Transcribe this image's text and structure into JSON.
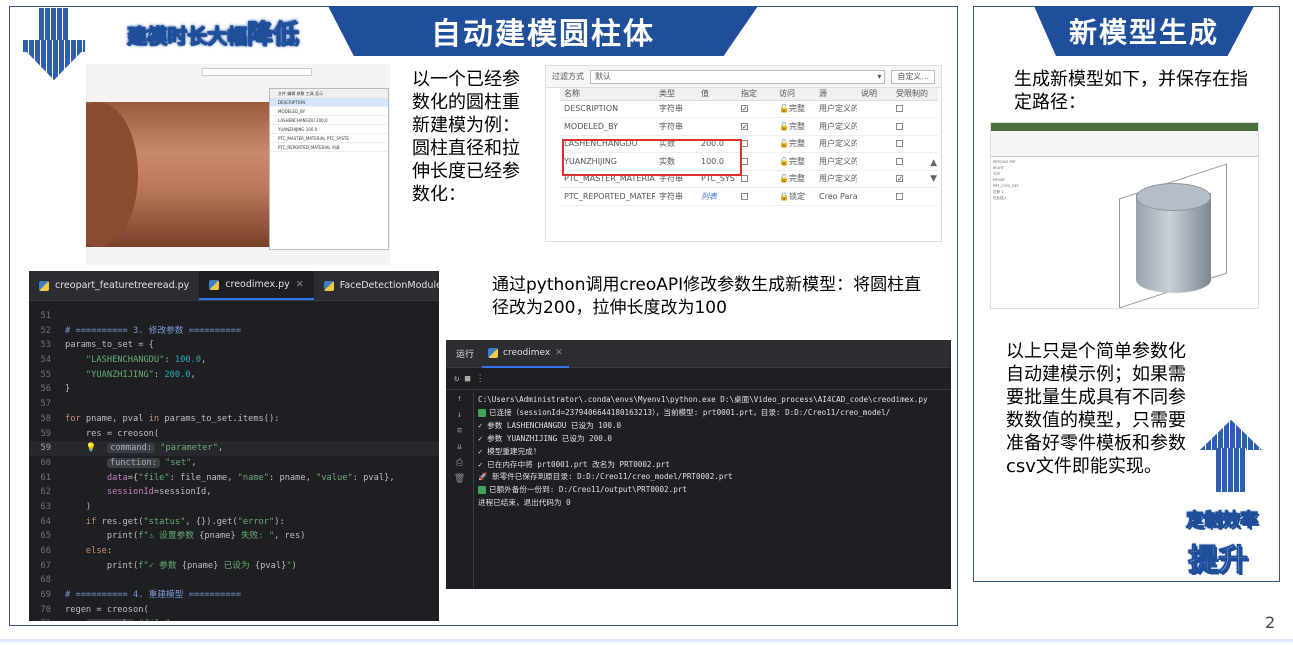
{
  "banners": {
    "left_title": "自动建模圆柱体",
    "right_title": "新模型生成"
  },
  "tags": {
    "reduce_prefix": "建模时长大幅",
    "reduce_big": "降低",
    "efficiency": "定制效率",
    "improve": "提升"
  },
  "texts": {
    "intro": "以一个已经参数化的圆柱重新建模为例：圆柱直径和拉伸长度已经参数化：",
    "python_desc": "通过python调用creoAPI修改参数生成新模型：将圆柱直径改为200，拉伸长度改为100",
    "new_model_desc": "生成新模型如下，并保存在指定路径：",
    "summary": "以上只是个简单参数化自动建模示例；如果需要批量生成具有不同参数数值的模型，只需要准备好零件模板和参数csv文件即能实现。"
  },
  "page_number": "2",
  "param_table": {
    "filter_label": "过滤方式",
    "filter_value": "默认",
    "custom_button": "自定义...",
    "headers": [
      "名称",
      "类型",
      "值",
      "指定",
      "访问",
      "源",
      "说明",
      "受限制的"
    ],
    "rows": [
      {
        "name": "DESCRIPTION",
        "type": "字符串",
        "value": "",
        "designated": true,
        "access": "🔓完整",
        "source": "用户定义的",
        "desc": "",
        "restricted": false
      },
      {
        "name": "MODELED_BY",
        "type": "字符串",
        "value": "",
        "designated": true,
        "access": "🔓完整",
        "source": "用户定义的",
        "desc": "",
        "restricted": false
      },
      {
        "name": "LASHENCHANGDU",
        "type": "实数",
        "value": "200.0",
        "designated": false,
        "access": "🔓完整",
        "source": "用户定义的",
        "desc": "",
        "restricted": false
      },
      {
        "name": "YUANZHIJING",
        "type": "实数",
        "value": "100.0",
        "designated": false,
        "access": "🔓完整",
        "source": "用户定义的",
        "desc": "",
        "restricted": false
      },
      {
        "name": "PTC_MASTER_MATERIAL",
        "type": "字符串",
        "value": "PTC_SYSTE",
        "designated": false,
        "access": "🔓完整",
        "source": "用户定义的",
        "desc": "",
        "restricted": true
      },
      {
        "name": "PTC_REPORTED_MATERIAL",
        "type": "字符串",
        "value": "列表",
        "designated": false,
        "access": "🔒锁定",
        "source": "Creo Para",
        "desc": "",
        "restricted": false
      }
    ]
  },
  "mini_dialog": {
    "menu": "文件  编辑  参数  工具  显示",
    "rows": [
      "DESCRIPTION",
      "MODELED_BY",
      "LASHENCHANGDU",
      "YUANZHIJING",
      "PTC_MASTER_MATERIAL",
      "PTC_REPORTED_MATERIAL"
    ],
    "values": [
      "",
      "",
      "200.0",
      "100.0",
      "PTC_SYSTE",
      "列表"
    ]
  },
  "editor": {
    "tabs": [
      "creopart_featuretreeread.py",
      "creodimex.py",
      "FaceDetectionModule.py"
    ],
    "active_tab": 1,
    "lines": [
      {
        "n": "51",
        "html": ""
      },
      {
        "n": "52",
        "html": "<span class=\"c-cm\"># ========== 3. 修改参数 ==========</span>"
      },
      {
        "n": "53",
        "html": "params_to_set = {"
      },
      {
        "n": "54",
        "html": "    <span class=\"c-st\">\"LASHENCHANGDU\"</span>: <span class=\"c-nm\">100.0</span>,"
      },
      {
        "n": "55",
        "html": "    <span class=\"c-st\">\"YUANZHIJING\"</span>: <span class=\"c-nm\">200.0</span>,"
      },
      {
        "n": "56",
        "html": "}"
      },
      {
        "n": "57",
        "html": ""
      },
      {
        "n": "58",
        "html": "<span class=\"c-kw\">for</span> pname, pval <span class=\"c-kw\">in</span> params_to_set.items():"
      },
      {
        "n": "59",
        "html": "    res = creoson("
      },
      {
        "n": "59",
        "html": "    💡  <span class=\"hint\">command:</span> <span class=\"c-st\">\"parameter\"</span>,",
        "cur": true
      },
      {
        "n": "60",
        "html": "        <span class=\"hint\">function:</span> <span class=\"c-st\">\"set\"</span>,"
      },
      {
        "n": "61",
        "html": "        <span class=\"c-pa\">data</span>={<span class=\"c-st\">\"file\"</span>: file_name, <span class=\"c-st\">\"name\"</span>: pname, <span class=\"c-st\">\"value\"</span>: pval},"
      },
      {
        "n": "62",
        "html": "        <span class=\"c-pa\">sessionId</span>=sessionId,"
      },
      {
        "n": "63",
        "html": "    )"
      },
      {
        "n": "64",
        "html": "    <span class=\"c-kw\">if</span> res.get(<span class=\"c-st\">\"status\"</span>, {}).get(<span class=\"c-st\">\"error\"</span>):"
      },
      {
        "n": "65",
        "html": "        print(<span class=\"c-st\">f\"⚠ 设置参数 </span>{pname}<span class=\"c-st\"> 失败: \"</span>, res)"
      },
      {
        "n": "66",
        "html": "    <span class=\"c-kw\">else</span>:"
      },
      {
        "n": "67",
        "html": "        print(<span class=\"c-st\">f\"✓ 参数 </span>{pname}<span class=\"c-st\"> 已设为 </span>{pval}<span class=\"c-st\">\"</span>)"
      },
      {
        "n": "68",
        "html": ""
      },
      {
        "n": "69",
        "html": "<span class=\"c-cm\"># ========== 4. 重建模型 ==========</span>"
      },
      {
        "n": "70",
        "html": "regen = creoson("
      },
      {
        "n": "71",
        "html": "    <span class=\"hint\">command:</span> <span class=\"c-st\">\"file\"</span>,"
      }
    ]
  },
  "terminal": {
    "run_label": "运行",
    "tab_label": "creodimex",
    "lines": [
      {
        "ok": false,
        "text": "C:\\Users\\Administrator\\.conda\\envs\\Myenv1\\python.exe D:\\桌面\\Video_process\\AI4CAD_code\\creodimex.py"
      },
      {
        "ok": true,
        "text": "已连接（sessionId=2379406644180163213），当前模型: prt0001.prt，目录: D:D:/Creo11/creo_model/"
      },
      {
        "ok": false,
        "text": "✓ 参数 LASHENCHANGDU 已设为 100.0"
      },
      {
        "ok": false,
        "text": "✓ 参数 YUANZHIJING 已设为 200.0"
      },
      {
        "ok": false,
        "text": "✓ 模型重建完成!"
      },
      {
        "ok": false,
        "text": "✓ 已在内存中将 prt0001.prt 改名为 PRT0002.prt"
      },
      {
        "ok": false,
        "text": "🚀 新零件已保存到原目录: D:D:/Creo11/creo_model/PRT0002.prt"
      },
      {
        "ok": true,
        "text": "已额外备份一份到: D:/Creo11/output\\PRT0002.prt"
      },
      {
        "ok": false,
        "text": ""
      },
      {
        "ok": false,
        "text": "进程已结束，退出代码为 0"
      }
    ]
  },
  "model_tree": [
    "PRT0002.PRT",
    "RIGHT",
    "TOP",
    "FRONT",
    "PRT_CSYS_DEF",
    "拉伸 1",
    "在此插入"
  ],
  "colors": {
    "brand": "#1f4e9b",
    "highlight_box": "#e03030"
  }
}
